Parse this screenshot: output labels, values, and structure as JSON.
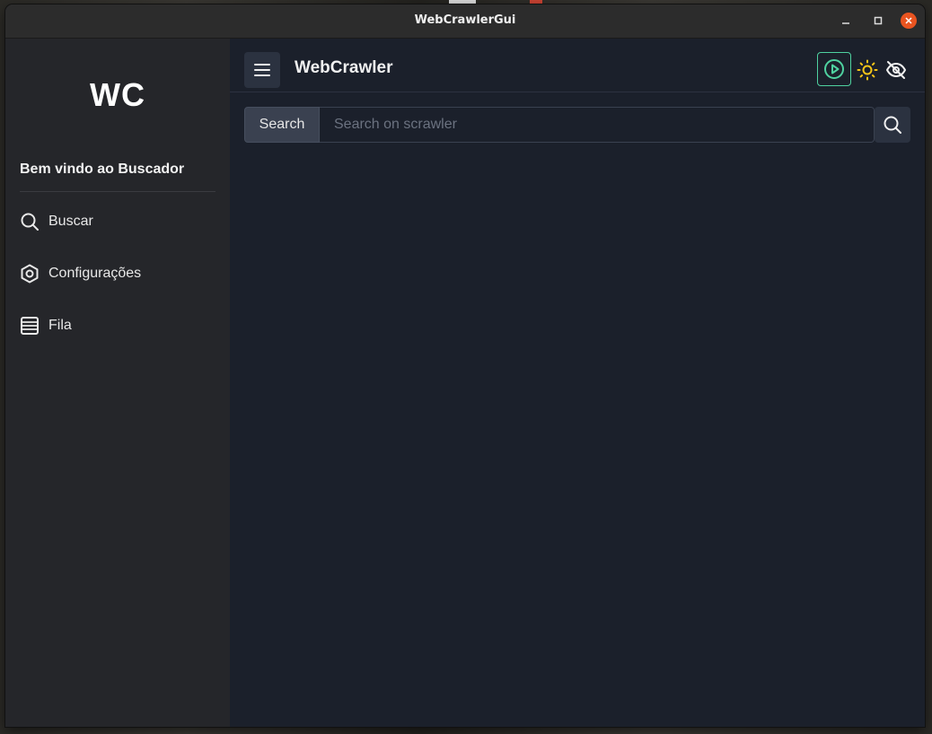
{
  "window": {
    "title": "WebCrawlerGui",
    "controls": {
      "minimize": "minimize-icon",
      "maximize": "maximize-icon",
      "close": "close-icon"
    }
  },
  "sidebar": {
    "logo": "WC",
    "welcome": "Bem vindo ao Buscador",
    "items": [
      {
        "label": "Buscar",
        "icon": "search-icon"
      },
      {
        "label": "Configurações",
        "icon": "settings-hexagon-icon"
      },
      {
        "label": "Fila",
        "icon": "list-icon"
      }
    ]
  },
  "header": {
    "title": "WebCrawler",
    "menu_icon": "hamburger-menu-icon",
    "actions": {
      "play": "play-circle-icon",
      "theme": "sun-icon",
      "visibility": "eye-off-icon"
    }
  },
  "search": {
    "addon_label": "Search",
    "value": "",
    "placeholder": "Search on scrawler",
    "button_icon": "search-icon"
  },
  "colors": {
    "main_bg": "#1b202b",
    "sidebar_bg": "#25262a",
    "play_accent": "#4fd1a0",
    "sun_accent": "#f5c518",
    "close_button": "#e95420"
  }
}
